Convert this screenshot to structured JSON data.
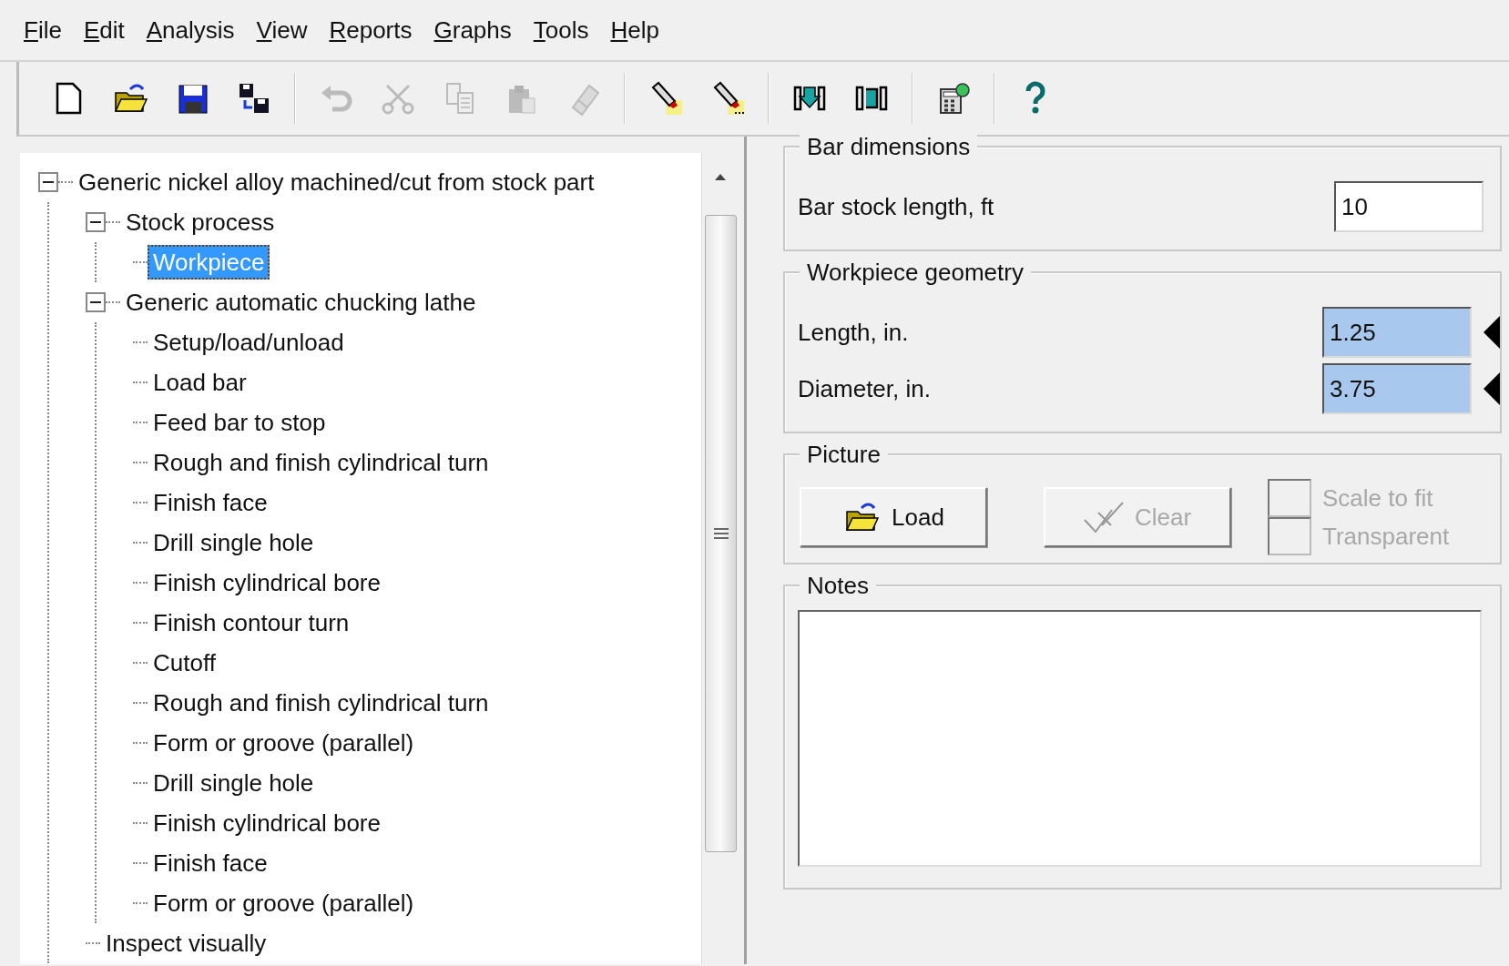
{
  "menu": [
    {
      "label": "File"
    },
    {
      "label": "Edit"
    },
    {
      "label": "Analysis"
    },
    {
      "label": "View"
    },
    {
      "label": "Reports"
    },
    {
      "label": "Graphs"
    },
    {
      "label": "Tools"
    },
    {
      "label": "Help"
    }
  ],
  "toolbar": [
    [
      {
        "disabled": false
      },
      {
        "disabled": false
      },
      {
        "disabled": false
      },
      {
        "disabled": false
      }
    ],
    [
      {
        "disabled": true
      },
      {
        "disabled": true
      },
      {
        "disabled": true
      },
      {
        "disabled": true
      },
      {
        "disabled": true
      }
    ],
    [
      {
        "disabled": false
      },
      {
        "disabled": false
      }
    ],
    [
      {
        "disabled": false
      },
      {
        "disabled": false
      }
    ],
    [
      {
        "disabled": false
      }
    ],
    [
      {
        "disabled": false
      }
    ]
  ],
  "tree": [
    {
      "label": "Generic nickel alloy machined/cut from stock part",
      "expanded": true,
      "selected": false,
      "children": [
        {
          "label": "Stock process",
          "expanded": true,
          "selected": false,
          "children": [
            {
              "label": "Workpiece",
              "selected": true
            }
          ]
        },
        {
          "label": "Generic automatic chucking lathe",
          "expanded": true,
          "selected": false,
          "children": [
            {
              "label": "Setup/load/unload",
              "selected": false
            },
            {
              "label": "Load bar",
              "selected": false
            },
            {
              "label": "Feed bar to stop",
              "selected": false
            },
            {
              "label": "Rough and finish cylindrical turn",
              "selected": false
            },
            {
              "label": "Finish face",
              "selected": false
            },
            {
              "label": "Drill single hole",
              "selected": false
            },
            {
              "label": "Finish cylindrical bore",
              "selected": false
            },
            {
              "label": "Finish contour turn",
              "selected": false
            },
            {
              "label": "Cutoff",
              "selected": false
            },
            {
              "label": "Rough and finish cylindrical turn",
              "selected": false
            },
            {
              "label": "Form or groove (parallel)",
              "selected": false
            },
            {
              "label": "Drill single hole",
              "selected": false
            },
            {
              "label": "Finish cylindrical bore",
              "selected": false
            },
            {
              "label": "Finish face",
              "selected": false
            },
            {
              "label": "Form or groove (parallel)",
              "selected": false
            }
          ]
        },
        {
          "label": "Inspect visually",
          "selected": false
        }
      ]
    }
  ],
  "bar_dimensions": {
    "title": "Bar dimensions",
    "fields": [
      {
        "label": "Bar stock length, ft",
        "value": "10",
        "highlighted": false
      }
    ]
  },
  "workpiece_geometry": {
    "title": "Workpiece geometry",
    "fields": [
      {
        "label": "Length, in.",
        "value": "1.25",
        "highlighted": true,
        "marker": true
      },
      {
        "label": "Diameter, in.",
        "value": "3.75",
        "highlighted": true,
        "marker": true
      }
    ]
  },
  "picture": {
    "title": "Picture",
    "buttons": [
      {
        "label": "Load",
        "disabled": false
      },
      {
        "label": "Clear",
        "disabled": true
      }
    ],
    "checkboxes": [
      {
        "label": "Scale to fit",
        "checked": false,
        "disabled": true
      },
      {
        "label": "Transparent",
        "checked": false,
        "disabled": true
      }
    ]
  },
  "notes": {
    "title": "Notes"
  }
}
